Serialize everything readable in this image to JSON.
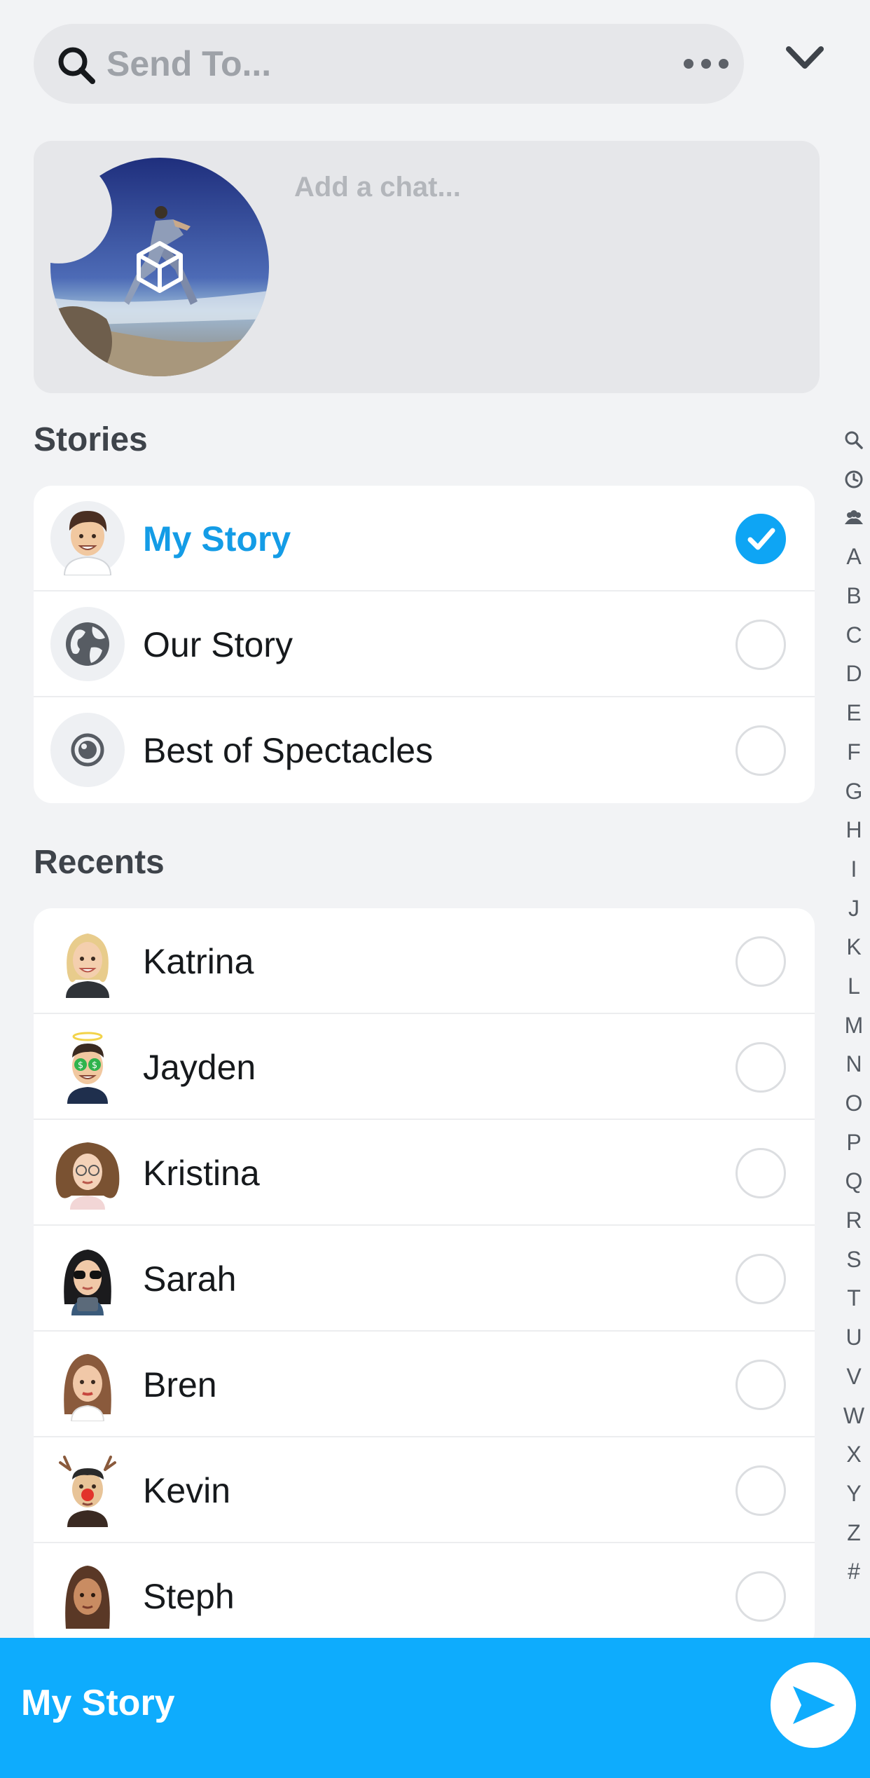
{
  "search": {
    "placeholder": "Send To...",
    "more_icon": "more-dots-icon",
    "collapse_icon": "chevron-down-icon"
  },
  "chat": {
    "placeholder": "Add a chat...",
    "thumbnail_icon": "spectacles-3d-cube-icon"
  },
  "stories": {
    "title": "Stories",
    "items": [
      {
        "label": "My Story",
        "selected": true,
        "icon": "bitmoji-avatar"
      },
      {
        "label": "Our Story",
        "selected": false,
        "icon": "globe-icon"
      },
      {
        "label": "Best of Spectacles",
        "selected": false,
        "icon": "spectacles-icon"
      }
    ]
  },
  "recents": {
    "title": "Recents",
    "items": [
      {
        "label": "Katrina",
        "selected": false
      },
      {
        "label": "Jayden",
        "selected": false
      },
      {
        "label": "Kristina",
        "selected": false
      },
      {
        "label": "Sarah",
        "selected": false
      },
      {
        "label": "Bren",
        "selected": false
      },
      {
        "label": "Kevin",
        "selected": false
      },
      {
        "label": "Steph",
        "selected": false
      }
    ]
  },
  "index": {
    "icons": [
      "search-icon",
      "recent-clock-icon",
      "groups-icon"
    ],
    "letters": [
      "A",
      "B",
      "C",
      "D",
      "E",
      "F",
      "G",
      "H",
      "I",
      "J",
      "K",
      "L",
      "M",
      "N",
      "O",
      "P",
      "Q",
      "R",
      "S",
      "T",
      "U",
      "V",
      "W",
      "X",
      "Y",
      "Z",
      "#"
    ]
  },
  "bottom": {
    "label": "My Story",
    "send_icon": "send-arrow-icon"
  },
  "colors": {
    "accent": "#0eacfd",
    "selected_text": "#149ce6",
    "background": "#f2f3f5"
  }
}
